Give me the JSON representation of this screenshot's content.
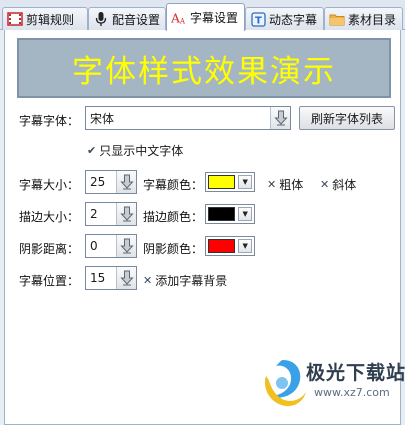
{
  "tabs": [
    {
      "label": "剪辑规则",
      "icon": "film-strip-icon",
      "active": false
    },
    {
      "label": "配音设置",
      "icon": "microphone-icon",
      "active": false
    },
    {
      "label": "字幕设置",
      "icon": "font-icon",
      "active": true
    },
    {
      "label": "动态字幕",
      "icon": "text-box-icon",
      "active": false
    },
    {
      "label": "素材目录",
      "icon": "folder-icon",
      "active": false
    }
  ],
  "preview": {
    "text": "字体样式效果演示",
    "text_color": "#ffff00"
  },
  "font": {
    "label": "字幕字体：",
    "value": "宋体",
    "refresh_button": "刷新字体列表",
    "chinese_only_label": "只显示中文字体",
    "chinese_only_checked": true
  },
  "size": {
    "label": "字幕大小：",
    "value": "25"
  },
  "subtitle_color": {
    "label": "字幕颜色：",
    "color": "#ffff00"
  },
  "bold": {
    "label": "粗体",
    "checked": false
  },
  "italic": {
    "label": "斜体",
    "checked": false
  },
  "stroke_size": {
    "label": "描边大小：",
    "value": "2"
  },
  "stroke_color": {
    "label": "描边颜色：",
    "color": "#000000"
  },
  "shadow_distance": {
    "label": "阴影距离：",
    "value": "0"
  },
  "shadow_color": {
    "label": "阴影颜色：",
    "color": "#ff0000"
  },
  "position": {
    "label": "字幕位置：",
    "value": "15"
  },
  "background": {
    "label": "添加字幕背景",
    "checked": false
  },
  "watermark": {
    "title": "极光下载站",
    "url": "www.xz7.com"
  }
}
